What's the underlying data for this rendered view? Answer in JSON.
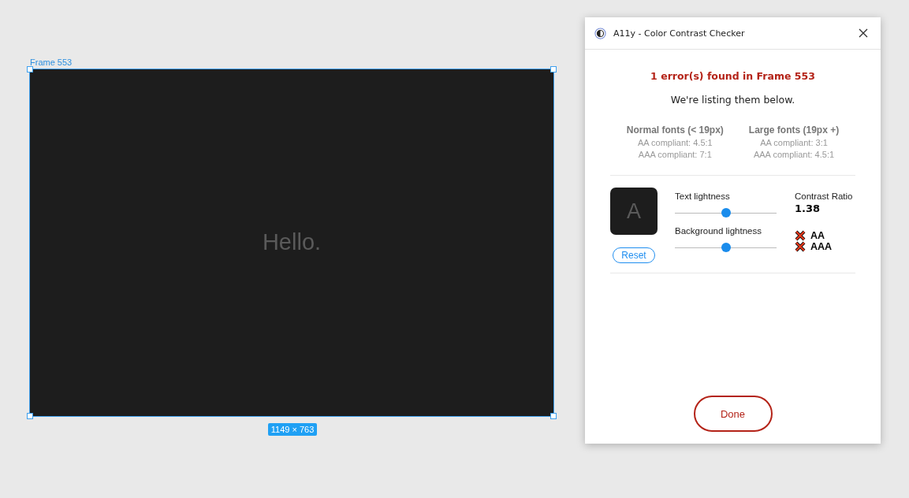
{
  "canvas": {
    "frame_label": "Frame 553",
    "frame_text": "Hello.",
    "size_badge": "1149 × 763",
    "selected": true
  },
  "panel": {
    "title": "A11y - Color Contrast Checker",
    "error_heading": "1 error(s) found in Frame 553",
    "subheading": "We're listing them below.",
    "guidelines": [
      {
        "heading": "Normal fonts (< 19px)",
        "lines": [
          "AA compliant: 4.5:1",
          "AAA compliant: 7:1"
        ]
      },
      {
        "heading": "Large fonts (19px +)",
        "lines": [
          "AA compliant: 3:1",
          "AAA compliant: 4.5:1"
        ]
      }
    ],
    "preview": {
      "letter": "A"
    },
    "reset_button": "Reset",
    "sliders": [
      {
        "label": "Text lightness",
        "level": 0.5
      },
      {
        "label": "Background lightness",
        "level": 0.5
      }
    ],
    "ratio_label": "Contrast Ratio",
    "ratio_value": "1.38",
    "results": [
      {
        "label": "AA",
        "passed": false
      },
      {
        "label": "AAA",
        "passed": false
      }
    ],
    "done_button": "Done"
  }
}
